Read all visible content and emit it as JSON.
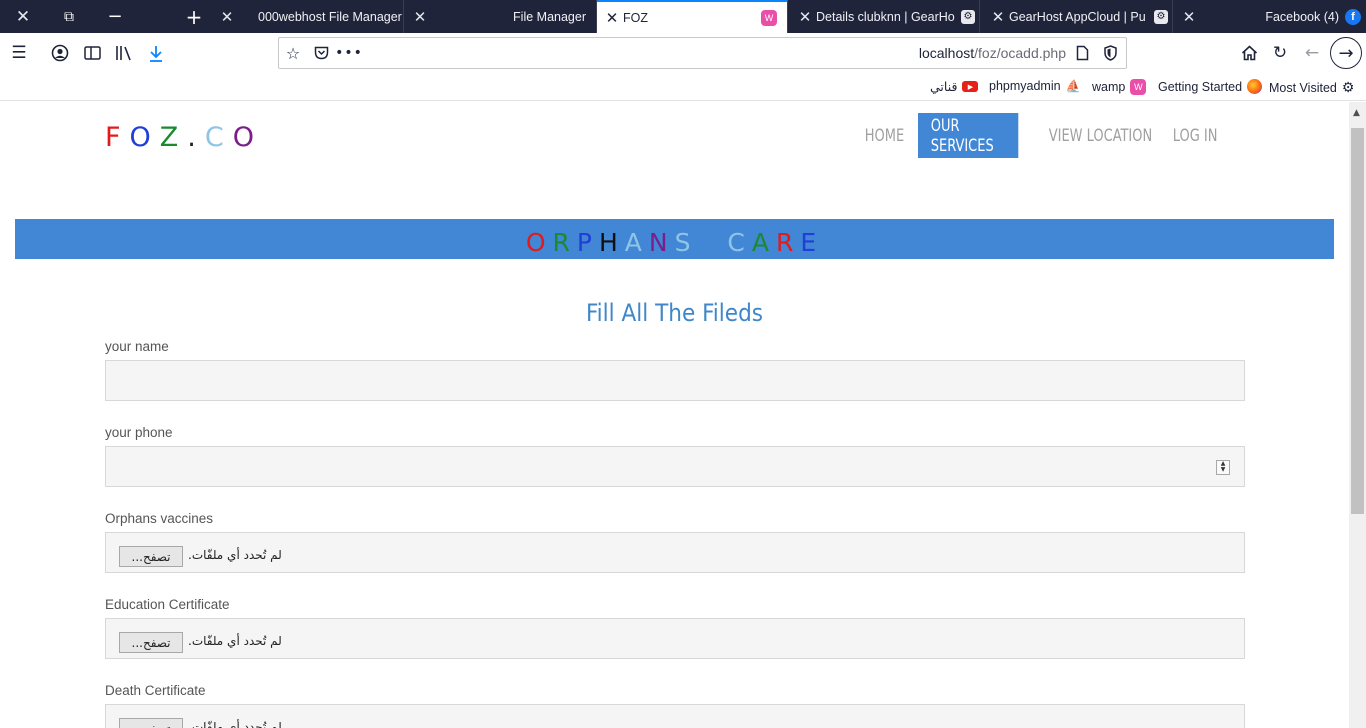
{
  "tabbar": {
    "tabs": [
      {
        "title": "000webhost File Manager",
        "active": false
      },
      {
        "title": "File Manager",
        "active": false
      },
      {
        "title": "FOZ",
        "active": true
      },
      {
        "title": "Details clubknn | GearHo",
        "active": false
      },
      {
        "title": "GearHost AppCloud | Pu",
        "active": false
      },
      {
        "title": "Facebook (4)",
        "active": false
      }
    ]
  },
  "navbar": {
    "url_host": "localhost",
    "url_path": "/foz/ocadd.php"
  },
  "bookmarks": [
    {
      "label": "قناتي",
      "icon": "youtube-icon"
    },
    {
      "label": "phpmyadmin",
      "icon": "phpmyadmin-icon"
    },
    {
      "label": "wamp",
      "icon": "wamp-icon"
    },
    {
      "label": "Getting Started",
      "icon": "firefox-icon"
    },
    {
      "label": "Most Visited",
      "icon": "gear-icon"
    }
  ],
  "site": {
    "logo_letters": [
      {
        "ch": "F",
        "color": "#e31a1c"
      },
      {
        "ch": "O",
        "color": "#1f3fd6"
      },
      {
        "ch": "Z",
        "color": "#1a8a2e"
      },
      {
        "ch": ".",
        "color": "#222222"
      },
      {
        "ch": "C",
        "color": "#8fc4e6"
      },
      {
        "ch": "O",
        "color": "#7a1f8a"
      }
    ],
    "menu": [
      {
        "label": "HOME",
        "active": false
      },
      {
        "label": "OUR SERVICES",
        "active": true
      },
      {
        "label": "VIEW LOCATION",
        "active": false
      },
      {
        "label": "LOG IN",
        "active": false
      }
    ],
    "banner_letters": [
      {
        "ch": "O",
        "color": "#e31a1c"
      },
      {
        "ch": "R",
        "color": "#1a8a2e"
      },
      {
        "ch": "P",
        "color": "#1f3fd6"
      },
      {
        "ch": "H",
        "color": "#111111"
      },
      {
        "ch": "A",
        "color": "#8fc4e6"
      },
      {
        "ch": "N",
        "color": "#7a1f8a"
      },
      {
        "ch": "S",
        "color": "#8fc4e6"
      },
      {
        "ch": " ",
        "color": "#000000"
      },
      {
        "ch": " ",
        "color": "#000000"
      },
      {
        "ch": "C",
        "color": "#8fc4e6"
      },
      {
        "ch": "A",
        "color": "#1a8a2e"
      },
      {
        "ch": "R",
        "color": "#e31a1c"
      },
      {
        "ch": "E",
        "color": "#1f3fd6"
      }
    ],
    "accent_color": "#4187d6"
  },
  "form": {
    "heading": "Fill All The Fileds",
    "fields": [
      {
        "label": "your name",
        "type": "text",
        "value": ""
      },
      {
        "label": "your phone",
        "type": "number",
        "value": ""
      },
      {
        "label": "Orphans vaccines",
        "type": "file",
        "button": "تصفح...",
        "status": "لم تُحدد أي ملفّات."
      },
      {
        "label": "Education Certificate",
        "type": "file",
        "button": "تصفح...",
        "status": "لم تُحدد أي ملفّات."
      },
      {
        "label": "Death Certificate",
        "type": "file",
        "button": "تصفح...",
        "status": "لم تُحدد أي ملفّات."
      }
    ]
  }
}
